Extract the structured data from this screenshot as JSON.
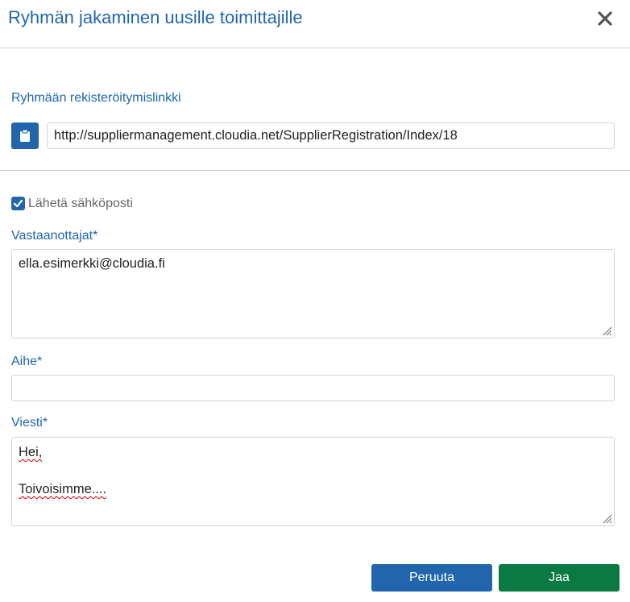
{
  "dialog": {
    "title": "Ryhmän jakaminen uusille toimittajille",
    "close_icon": "close-icon"
  },
  "registration": {
    "label": "Ryhmään rekisteröitymislinkki",
    "copy_icon": "clipboard-icon",
    "link": "http://suppliermanagement.cloudia.net/SupplierRegistration/Index/18"
  },
  "email": {
    "send_label": "Lähetä sähköposti",
    "send_checked": true,
    "recipients_label": "Vastaanottajat*",
    "recipients_value": "ella.esimerkki@cloudia.fi",
    "subject_label": "Aihe*",
    "subject_value": "",
    "message_label": "Viesti*",
    "message_line1": "Hei,",
    "message_line2": "Toivoisimme...."
  },
  "buttons": {
    "cancel_label": "Peruuta",
    "share_label": "Jaa"
  },
  "colors": {
    "accent": "#2166ad",
    "primary_action": "#0b7a42",
    "border": "#d4d4d4"
  }
}
